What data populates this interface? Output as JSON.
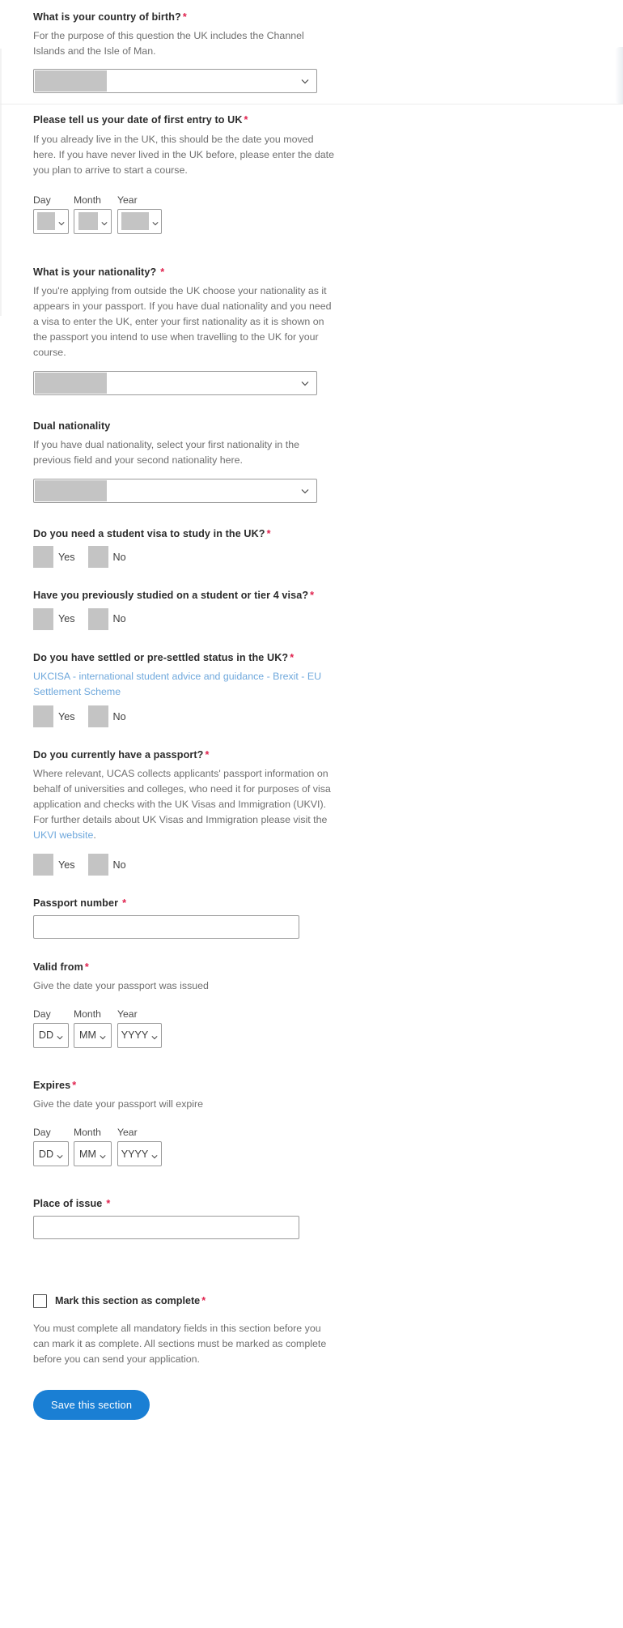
{
  "form": {
    "country_of_birth": {
      "label": "What is your country of birth?",
      "required_marker": "*",
      "hint": "For the purpose of this question the UK includes the Channel Islands and the Isle of Man.",
      "value": ""
    },
    "first_entry": {
      "label": "Please tell us your date of first entry to UK",
      "required_marker": "*",
      "hint": "If you already live in the UK, this should be the date you moved here. If you have never lived in the UK before, please enter the date you plan to arrive to start a course.",
      "day_header": "Day",
      "month_header": "Month",
      "year_header": "Year",
      "day_value": "",
      "month_value": "",
      "year_value": ""
    },
    "nationality": {
      "label": "What is your nationality?",
      "required_marker": "*",
      "hint": "If you're applying from outside the UK choose your nationality as it appears in your passport. If you have dual nationality and you need a visa to enter the UK, enter your first nationality as it is shown on the passport you intend to use when travelling to the UK for your course.",
      "value": ""
    },
    "dual_nationality": {
      "label": "Dual nationality",
      "hint": "If you have dual nationality, select your first nationality in the previous field and your second nationality here.",
      "value": ""
    },
    "student_visa": {
      "label": "Do you need a student visa to study in the UK?",
      "required_marker": "*",
      "yes_label": "Yes",
      "no_label": "No"
    },
    "previous_study": {
      "label": "Have you previously studied on a student or tier 4 visa?",
      "required_marker": "*",
      "yes_label": "Yes",
      "no_label": "No"
    },
    "settled_status": {
      "label": "Do you have settled or pre-settled status in the UK?",
      "required_marker": "*",
      "link_text": "UKCISA - international student advice and guidance - Brexit - EU Settlement Scheme",
      "yes_label": "Yes",
      "no_label": "No"
    },
    "passport_question": {
      "label": "Do you currently have a passport?",
      "required_marker": "*",
      "hint_part1": "Where relevant, UCAS collects applicants' passport information on behalf of universities and colleges, who need it for purposes of visa application and checks with the UK Visas and Immigration (UKVI). For further details about UK Visas and Immigration please visit the ",
      "hint_link": "UKVI website",
      "hint_part2": ".",
      "yes_label": "Yes",
      "no_label": "No"
    },
    "passport_number": {
      "label": "Passport number",
      "required_marker": "*",
      "value": "",
      "placeholder": ""
    },
    "valid_from": {
      "label": "Valid from",
      "required_marker": "*",
      "hint": "Give the date your passport was issued",
      "day_header": "Day",
      "month_header": "Month",
      "year_header": "Year",
      "day_value": "DD",
      "month_value": "MM",
      "year_value": "YYYY"
    },
    "expires": {
      "label": "Expires",
      "required_marker": "*",
      "hint": "Give the date your passport will expire",
      "day_header": "Day",
      "month_header": "Month",
      "year_header": "Year",
      "day_value": "DD",
      "month_value": "MM",
      "year_value": "YYYY"
    },
    "place_of_issue": {
      "label": "Place of issue",
      "required_marker": "*",
      "value": "",
      "placeholder": ""
    },
    "mark_complete": {
      "label": "Mark this section as complete",
      "required_marker": "*",
      "checked": false,
      "hint": "You must complete all mandatory fields in this section before you can mark it as complete. All sections must be marked as complete before you can send your application."
    },
    "save_button": {
      "label": "Save this section"
    }
  },
  "colors": {
    "required_red": "#e0224e",
    "link_blue": "#6fa8dc",
    "button_blue": "#1a7fd4",
    "redaction_grey": "#c4c4c4",
    "border_grey": "#9a9a9a"
  }
}
